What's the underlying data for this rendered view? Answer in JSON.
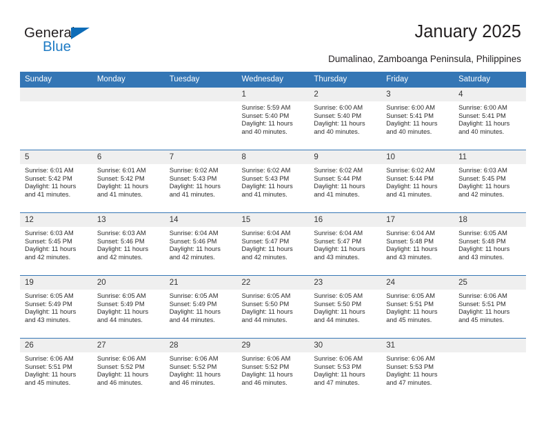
{
  "logo": {
    "word_top": "General",
    "word_bottom": "Blue",
    "triangle": "blue-triangle-icon",
    "color_dark": "#231f20",
    "color_blue": "#1e7bc4"
  },
  "header": {
    "title": "January 2025",
    "subtitle": "Dumalinao, Zamboanga Peninsula, Philippines",
    "accent_color": "#3476b5"
  },
  "calendar": {
    "weekday_headers": [
      "Sunday",
      "Monday",
      "Tuesday",
      "Wednesday",
      "Thursday",
      "Friday",
      "Saturday"
    ],
    "labels": {
      "sunrise": "Sunrise:",
      "sunset": "Sunset:",
      "daylight": "Daylight:"
    },
    "weeks": [
      [
        {
          "day": "",
          "empty": true
        },
        {
          "day": "",
          "empty": true
        },
        {
          "day": "",
          "empty": true
        },
        {
          "day": "1",
          "sunrise": "Sunrise: 5:59 AM",
          "sunset": "Sunset: 5:40 PM",
          "daylight_line1": "Daylight: 11 hours",
          "daylight_line2": "and 40 minutes."
        },
        {
          "day": "2",
          "sunrise": "Sunrise: 6:00 AM",
          "sunset": "Sunset: 5:40 PM",
          "daylight_line1": "Daylight: 11 hours",
          "daylight_line2": "and 40 minutes."
        },
        {
          "day": "3",
          "sunrise": "Sunrise: 6:00 AM",
          "sunset": "Sunset: 5:41 PM",
          "daylight_line1": "Daylight: 11 hours",
          "daylight_line2": "and 40 minutes."
        },
        {
          "day": "4",
          "sunrise": "Sunrise: 6:00 AM",
          "sunset": "Sunset: 5:41 PM",
          "daylight_line1": "Daylight: 11 hours",
          "daylight_line2": "and 40 minutes."
        }
      ],
      [
        {
          "day": "5",
          "sunrise": "Sunrise: 6:01 AM",
          "sunset": "Sunset: 5:42 PM",
          "daylight_line1": "Daylight: 11 hours",
          "daylight_line2": "and 41 minutes."
        },
        {
          "day": "6",
          "sunrise": "Sunrise: 6:01 AM",
          "sunset": "Sunset: 5:42 PM",
          "daylight_line1": "Daylight: 11 hours",
          "daylight_line2": "and 41 minutes."
        },
        {
          "day": "7",
          "sunrise": "Sunrise: 6:02 AM",
          "sunset": "Sunset: 5:43 PM",
          "daylight_line1": "Daylight: 11 hours",
          "daylight_line2": "and 41 minutes."
        },
        {
          "day": "8",
          "sunrise": "Sunrise: 6:02 AM",
          "sunset": "Sunset: 5:43 PM",
          "daylight_line1": "Daylight: 11 hours",
          "daylight_line2": "and 41 minutes."
        },
        {
          "day": "9",
          "sunrise": "Sunrise: 6:02 AM",
          "sunset": "Sunset: 5:44 PM",
          "daylight_line1": "Daylight: 11 hours",
          "daylight_line2": "and 41 minutes."
        },
        {
          "day": "10",
          "sunrise": "Sunrise: 6:02 AM",
          "sunset": "Sunset: 5:44 PM",
          "daylight_line1": "Daylight: 11 hours",
          "daylight_line2": "and 41 minutes."
        },
        {
          "day": "11",
          "sunrise": "Sunrise: 6:03 AM",
          "sunset": "Sunset: 5:45 PM",
          "daylight_line1": "Daylight: 11 hours",
          "daylight_line2": "and 42 minutes."
        }
      ],
      [
        {
          "day": "12",
          "sunrise": "Sunrise: 6:03 AM",
          "sunset": "Sunset: 5:45 PM",
          "daylight_line1": "Daylight: 11 hours",
          "daylight_line2": "and 42 minutes."
        },
        {
          "day": "13",
          "sunrise": "Sunrise: 6:03 AM",
          "sunset": "Sunset: 5:46 PM",
          "daylight_line1": "Daylight: 11 hours",
          "daylight_line2": "and 42 minutes."
        },
        {
          "day": "14",
          "sunrise": "Sunrise: 6:04 AM",
          "sunset": "Sunset: 5:46 PM",
          "daylight_line1": "Daylight: 11 hours",
          "daylight_line2": "and 42 minutes."
        },
        {
          "day": "15",
          "sunrise": "Sunrise: 6:04 AM",
          "sunset": "Sunset: 5:47 PM",
          "daylight_line1": "Daylight: 11 hours",
          "daylight_line2": "and 42 minutes."
        },
        {
          "day": "16",
          "sunrise": "Sunrise: 6:04 AM",
          "sunset": "Sunset: 5:47 PM",
          "daylight_line1": "Daylight: 11 hours",
          "daylight_line2": "and 43 minutes."
        },
        {
          "day": "17",
          "sunrise": "Sunrise: 6:04 AM",
          "sunset": "Sunset: 5:48 PM",
          "daylight_line1": "Daylight: 11 hours",
          "daylight_line2": "and 43 minutes."
        },
        {
          "day": "18",
          "sunrise": "Sunrise: 6:05 AM",
          "sunset": "Sunset: 5:48 PM",
          "daylight_line1": "Daylight: 11 hours",
          "daylight_line2": "and 43 minutes."
        }
      ],
      [
        {
          "day": "19",
          "sunrise": "Sunrise: 6:05 AM",
          "sunset": "Sunset: 5:49 PM",
          "daylight_line1": "Daylight: 11 hours",
          "daylight_line2": "and 43 minutes."
        },
        {
          "day": "20",
          "sunrise": "Sunrise: 6:05 AM",
          "sunset": "Sunset: 5:49 PM",
          "daylight_line1": "Daylight: 11 hours",
          "daylight_line2": "and 44 minutes."
        },
        {
          "day": "21",
          "sunrise": "Sunrise: 6:05 AM",
          "sunset": "Sunset: 5:49 PM",
          "daylight_line1": "Daylight: 11 hours",
          "daylight_line2": "and 44 minutes."
        },
        {
          "day": "22",
          "sunrise": "Sunrise: 6:05 AM",
          "sunset": "Sunset: 5:50 PM",
          "daylight_line1": "Daylight: 11 hours",
          "daylight_line2": "and 44 minutes."
        },
        {
          "day": "23",
          "sunrise": "Sunrise: 6:05 AM",
          "sunset": "Sunset: 5:50 PM",
          "daylight_line1": "Daylight: 11 hours",
          "daylight_line2": "and 44 minutes."
        },
        {
          "day": "24",
          "sunrise": "Sunrise: 6:05 AM",
          "sunset": "Sunset: 5:51 PM",
          "daylight_line1": "Daylight: 11 hours",
          "daylight_line2": "and 45 minutes."
        },
        {
          "day": "25",
          "sunrise": "Sunrise: 6:06 AM",
          "sunset": "Sunset: 5:51 PM",
          "daylight_line1": "Daylight: 11 hours",
          "daylight_line2": "and 45 minutes."
        }
      ],
      [
        {
          "day": "26",
          "sunrise": "Sunrise: 6:06 AM",
          "sunset": "Sunset: 5:51 PM",
          "daylight_line1": "Daylight: 11 hours",
          "daylight_line2": "and 45 minutes."
        },
        {
          "day": "27",
          "sunrise": "Sunrise: 6:06 AM",
          "sunset": "Sunset: 5:52 PM",
          "daylight_line1": "Daylight: 11 hours",
          "daylight_line2": "and 46 minutes."
        },
        {
          "day": "28",
          "sunrise": "Sunrise: 6:06 AM",
          "sunset": "Sunset: 5:52 PM",
          "daylight_line1": "Daylight: 11 hours",
          "daylight_line2": "and 46 minutes."
        },
        {
          "day": "29",
          "sunrise": "Sunrise: 6:06 AM",
          "sunset": "Sunset: 5:52 PM",
          "daylight_line1": "Daylight: 11 hours",
          "daylight_line2": "and 46 minutes."
        },
        {
          "day": "30",
          "sunrise": "Sunrise: 6:06 AM",
          "sunset": "Sunset: 5:53 PM",
          "daylight_line1": "Daylight: 11 hours",
          "daylight_line2": "and 47 minutes."
        },
        {
          "day": "31",
          "sunrise": "Sunrise: 6:06 AM",
          "sunset": "Sunset: 5:53 PM",
          "daylight_line1": "Daylight: 11 hours",
          "daylight_line2": "and 47 minutes."
        },
        {
          "day": "",
          "empty": true
        }
      ]
    ]
  }
}
